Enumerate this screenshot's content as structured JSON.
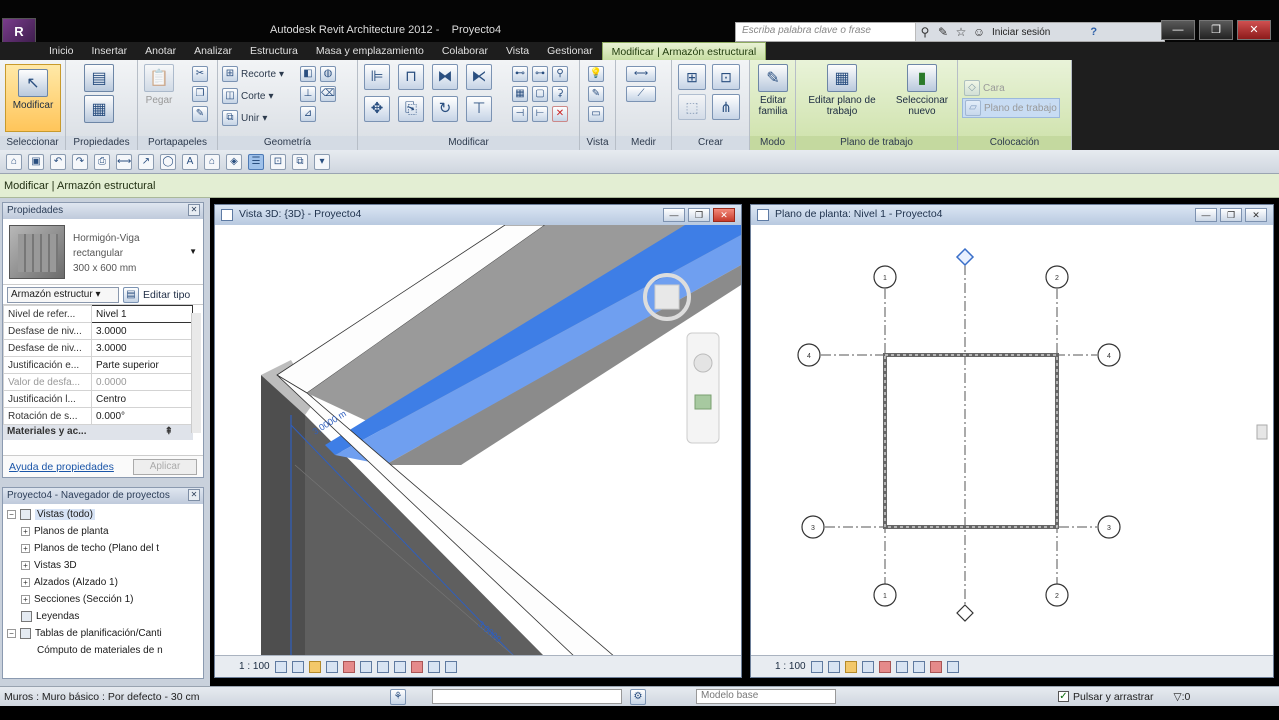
{
  "title": {
    "app": "Autodesk Revit Architecture 2012 -",
    "project": "Proyecto4"
  },
  "help": {
    "search_placeholder": "Escriba palabra clave o frase",
    "login": "Iniciar sesión",
    "help_label": "?"
  },
  "tabs": [
    "Inicio",
    "Insertar",
    "Anotar",
    "Analizar",
    "Estructura",
    "Masa y emplazamiento",
    "Colaborar",
    "Vista",
    "Gestionar",
    "Modificar | Armazón estructural"
  ],
  "ribbon": {
    "modify_label": "Modificar",
    "select_panel": "Seleccionar",
    "props_panel": "Propiedades",
    "clipboard_panel": "Portapapeles",
    "paste_label": "Pegar",
    "geometry_panel": "Geometría",
    "cut_label": "Recorte",
    "corte_label": "Corte",
    "unir_label": "Unir",
    "modify_panel": "Modificar",
    "view_panel": "Vista",
    "measure_panel": "Medir",
    "create_panel": "Crear",
    "mode_panel": "Modo",
    "edit_family": "Editar familia",
    "workplane_panel": "Plano de trabajo",
    "edit_workplane": "Editar plano de trabajo",
    "select_new": "Seleccionar nuevo",
    "placement_panel": "Colocación",
    "face_label": "Cara",
    "workplane_label": "Plano de trabajo"
  },
  "context_bar": "Modificar | Armazón estructural",
  "properties": {
    "title": "Propiedades",
    "type_name": [
      "Hormigón-Viga",
      "rectangular",
      "300 x 600 mm"
    ],
    "filter": "Armazón estructur",
    "edit_type": "Editar tipo",
    "rows": [
      {
        "k": "Nivel de refer...",
        "v": "Nivel 1"
      },
      {
        "k": "Desfase de niv...",
        "v": "3.0000"
      },
      {
        "k": "Desfase de niv...",
        "v": "3.0000"
      },
      {
        "k": "Justificación e...",
        "v": "Parte superior"
      },
      {
        "k": "Valor de desfa...",
        "v": "0.0000"
      },
      {
        "k": "Justificación l...",
        "v": "Centro"
      },
      {
        "k": "Rotación de s...",
        "v": "0.000°"
      }
    ],
    "section": "Materiales y ac...",
    "help_link": "Ayuda de propiedades",
    "apply": "Aplicar"
  },
  "browser": {
    "title": "Proyecto4 - Navegador de proyectos",
    "items": [
      "Vistas (todo)",
      "Planos de planta",
      "Planos de techo (Plano del t",
      "Vistas 3D",
      "Alzados (Alzado 1)",
      "Secciones (Sección 1)",
      "Leyendas",
      "Tablas de planificación/Canti",
      "Cómputo de materiales de n"
    ]
  },
  "view3d": {
    "title": "Vista 3D: {3D} - Proyecto4",
    "scale": "1 : 100"
  },
  "viewplan": {
    "title": "Plano de planta: Nivel 1 - Proyecto4",
    "scale": "1 : 100"
  },
  "status": {
    "message": "Muros : Muro básico : Por defecto - 30 cm",
    "model": "Modelo base",
    "drag": "Pulsar y arrastrar",
    "filter": ":0"
  }
}
